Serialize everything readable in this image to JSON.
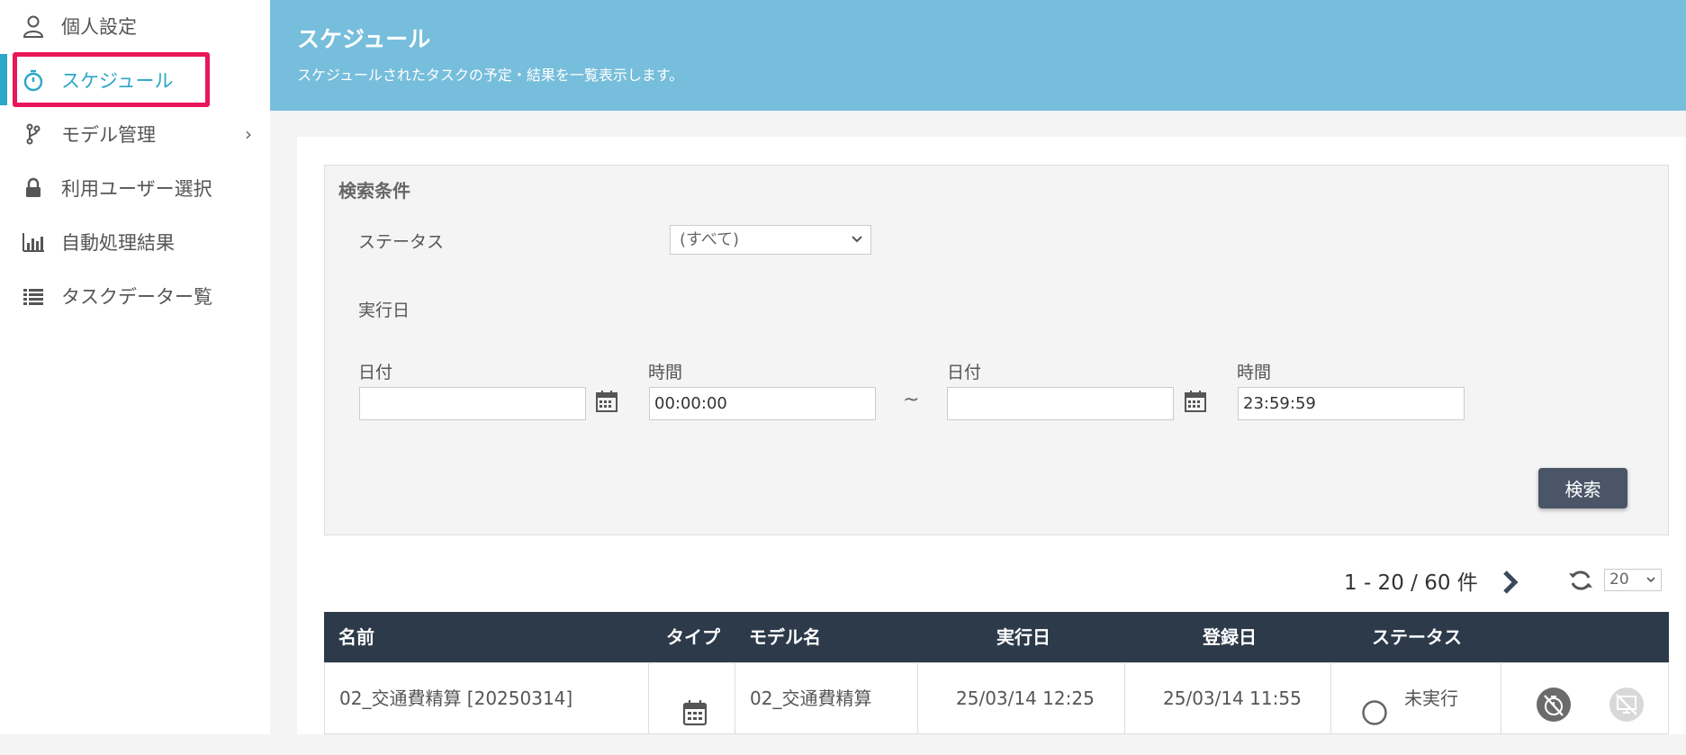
{
  "sidebar": {
    "items": [
      {
        "label": "個人設定",
        "icon": "user-icon"
      },
      {
        "label": "スケジュール",
        "icon": "stopwatch-icon"
      },
      {
        "label": "モデル管理",
        "icon": "branch-icon"
      },
      {
        "label": "利用ユーザー選択",
        "icon": "lock-icon"
      },
      {
        "label": "自動処理結果",
        "icon": "bar-chart-icon"
      },
      {
        "label": "タスクデーター覧",
        "icon": "list-icon"
      }
    ]
  },
  "header": {
    "title": "スケジュール",
    "subtitle": "スケジュールされたタスクの予定・結果を一覧表示します。"
  },
  "search": {
    "title": "検索条件",
    "status_label": "ステータス",
    "status_value": "(すべて)",
    "run_date_label": "実行日",
    "from_date_label": "日付",
    "from_time_label": "時間",
    "from_date_value": "",
    "from_time_value": "00:00:00",
    "tilde": "~",
    "to_date_label": "日付",
    "to_time_label": "時間",
    "to_date_value": "",
    "to_time_value": "23:59:59",
    "button_label": "検索"
  },
  "pagination": {
    "summary": "1 - 20 / 60 件",
    "page_size": "20"
  },
  "table": {
    "columns": [
      "名前",
      "タイプ",
      "モデル名",
      "実行日",
      "登録日",
      "ステータス"
    ],
    "rows": [
      {
        "name": "02_交通費精算 [20250314]",
        "type_icon": "calendar-icon",
        "model": "02_交通費精算",
        "run_date": "25/03/14 12:25",
        "reg_date": "25/03/14 11:55",
        "status": "未実行"
      }
    ]
  },
  "colors": {
    "accent": "#2aa7c9",
    "header_bg": "#76bedb",
    "table_header_bg": "#2d3a4a",
    "highlight": "#e8185a",
    "button_bg": "#4a5568"
  }
}
